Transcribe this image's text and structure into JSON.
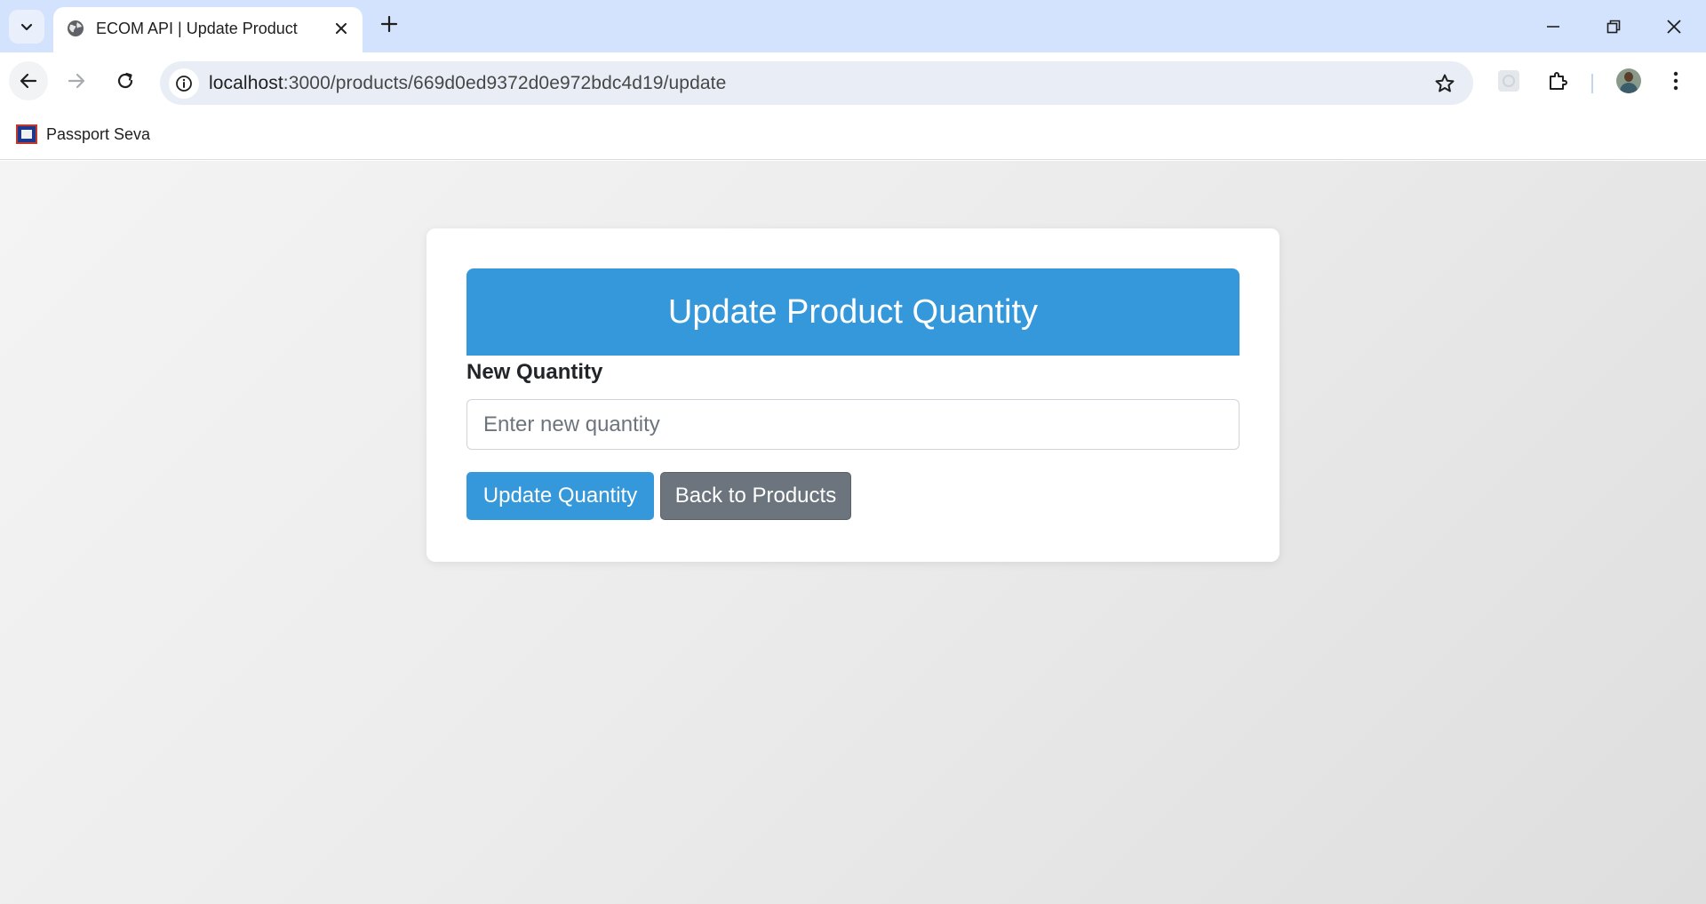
{
  "browser": {
    "tab": {
      "title": "ECOM API | Update Product",
      "favicon": "globe-icon"
    },
    "address_bar": {
      "host": "localhost",
      "path": ":3000/products/669d0ed9372d0e972bdc4d19/update"
    },
    "bookmarks": [
      {
        "label": "Passport Seva",
        "icon": "passport-seva-favicon"
      }
    ]
  },
  "form": {
    "title": "Update Product Quantity",
    "quantity_label": "New Quantity",
    "quantity_value": "",
    "quantity_placeholder": "Enter new quantity",
    "submit_label": "Update Quantity",
    "back_label": "Back to Products"
  },
  "colors": {
    "primary": "#3498db",
    "secondary": "#6c757d",
    "tabstrip": "#d3e3fd"
  }
}
